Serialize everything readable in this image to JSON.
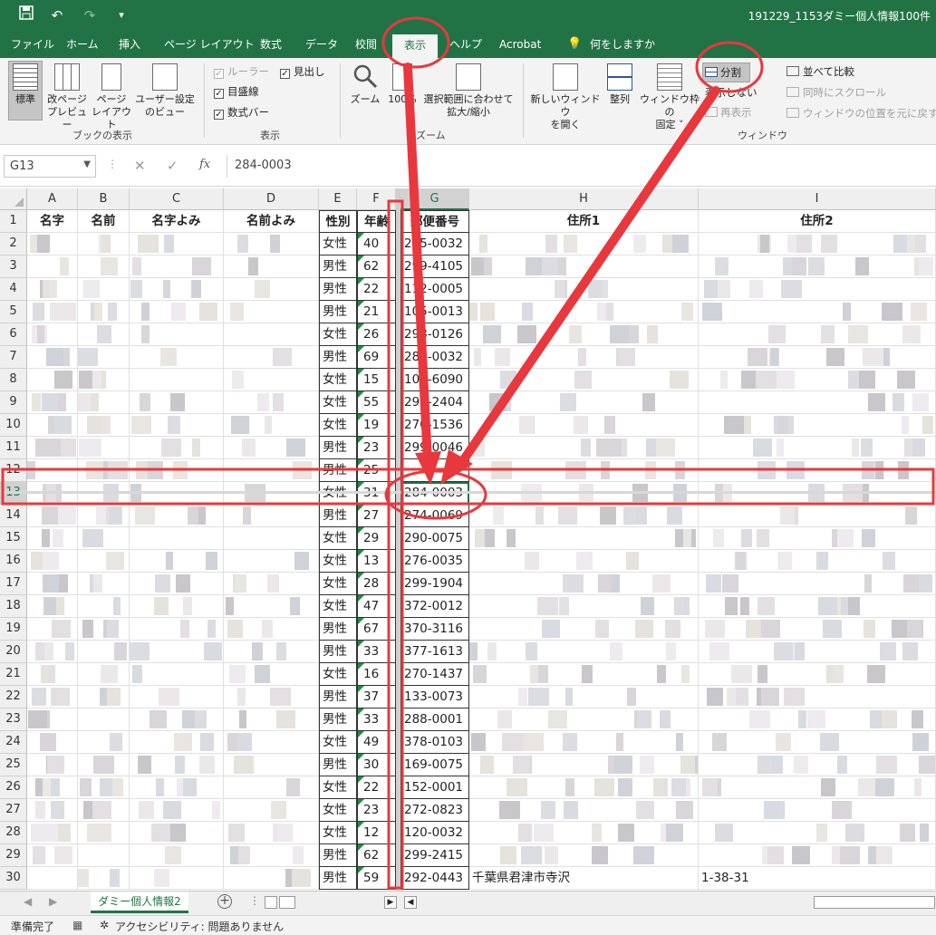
{
  "window": {
    "title": "191229_1153ダミー個人情報100件"
  },
  "qat": {
    "save_icon": "save-icon",
    "undo_icon": "undo-icon",
    "redo_icon": "redo-icon",
    "customize_icon": "customize-icon"
  },
  "tabs": [
    {
      "label": "ファイル"
    },
    {
      "label": "ホーム"
    },
    {
      "label": "挿入"
    },
    {
      "label": "ページ レイアウト"
    },
    {
      "label": "数式"
    },
    {
      "label": "データ"
    },
    {
      "label": "校閲"
    },
    {
      "label": "表示"
    },
    {
      "label": "ヘルプ"
    },
    {
      "label": "Acrobat"
    },
    {
      "label": "何をしますか"
    }
  ],
  "ribbon": {
    "workbook_views": {
      "group_label": "ブックの表示",
      "normal": "標準",
      "page_break_1": "改ページ",
      "page_break_2": "プレビュー",
      "page_layout_1": "ページ",
      "page_layout_2": "レイアウト",
      "custom_1": "ユーザー設定",
      "custom_2": "のビュー"
    },
    "show": {
      "group_label": "表示",
      "ruler": "ルーラー",
      "gridlines": "目盛線",
      "formula_bar": "数式バー",
      "headings": "見出し"
    },
    "zoom": {
      "group_label": "ズーム",
      "zoom": "ズーム",
      "zoom100": "100%",
      "zoom_sel_1": "選択範囲に合わせて",
      "zoom_sel_2": "拡大/縮小"
    },
    "window": {
      "group_label": "ウィンドウ",
      "new_window_1": "新しいウィンドウ",
      "new_window_2": "を開く",
      "arrange": "整列",
      "freeze_1": "ウィンドウ枠の",
      "freeze_2": "固定 ˅",
      "split": "分割",
      "hide": "表示しない",
      "unhide": "再表示",
      "side_by_side": "並べて比較",
      "sync_scroll": "同時にスクロール",
      "reset_pos": "ウィンドウの位置を元に戻す"
    }
  },
  "formula_bar": {
    "name_box": "G13",
    "cancel": "✕",
    "enter": "✓",
    "fx": "fx",
    "content": "284-0003"
  },
  "columns": [
    "A",
    "B",
    "C",
    "D",
    "E",
    "F",
    "G",
    "H",
    "I"
  ],
  "headers": [
    "名字",
    "名前",
    "名字よみ",
    "名前よみ",
    "性別",
    "年齢",
    "郵便番号",
    "住所1",
    "住所2"
  ],
  "rows": [
    {
      "n": "2",
      "gender": "女性",
      "age": "40",
      "zip": "285-0032"
    },
    {
      "n": "3",
      "gender": "男性",
      "age": "62",
      "zip": "299-4105"
    },
    {
      "n": "4",
      "gender": "男性",
      "age": "22",
      "zip": "112-0005"
    },
    {
      "n": "5",
      "gender": "男性",
      "age": "21",
      "zip": "105-0013"
    },
    {
      "n": "6",
      "gender": "女性",
      "age": "26",
      "zip": "298-0126"
    },
    {
      "n": "7",
      "gender": "男性",
      "age": "69",
      "zip": "283-0032"
    },
    {
      "n": "8",
      "gender": "女性",
      "age": "15",
      "zip": "100-6090"
    },
    {
      "n": "9",
      "gender": "女性",
      "age": "55",
      "zip": "299-2404"
    },
    {
      "n": "10",
      "gender": "女性",
      "age": "19",
      "zip": "270-1536"
    },
    {
      "n": "11",
      "gender": "男性",
      "age": "23",
      "zip": "299-0046"
    },
    {
      "n": "12",
      "gender": "男性",
      "age": "25",
      "zip": ""
    },
    {
      "n": "13",
      "gender": "女性",
      "age": "31",
      "zip": "284-0003"
    },
    {
      "n": "14",
      "gender": "男性",
      "age": "27",
      "zip": "274-0069"
    },
    {
      "n": "15",
      "gender": "女性",
      "age": "29",
      "zip": "290-0075"
    },
    {
      "n": "16",
      "gender": "女性",
      "age": "13",
      "zip": "276-0035"
    },
    {
      "n": "17",
      "gender": "女性",
      "age": "28",
      "zip": "299-1904"
    },
    {
      "n": "18",
      "gender": "女性",
      "age": "47",
      "zip": "372-0012"
    },
    {
      "n": "19",
      "gender": "男性",
      "age": "67",
      "zip": "370-3116"
    },
    {
      "n": "20",
      "gender": "男性",
      "age": "33",
      "zip": "377-1613"
    },
    {
      "n": "21",
      "gender": "女性",
      "age": "16",
      "zip": "270-1437"
    },
    {
      "n": "22",
      "gender": "男性",
      "age": "37",
      "zip": "133-0073"
    },
    {
      "n": "23",
      "gender": "男性",
      "age": "33",
      "zip": "288-0001"
    },
    {
      "n": "24",
      "gender": "女性",
      "age": "49",
      "zip": "378-0103"
    },
    {
      "n": "25",
      "gender": "男性",
      "age": "30",
      "zip": "169-0075"
    },
    {
      "n": "26",
      "gender": "女性",
      "age": "22",
      "zip": "152-0001"
    },
    {
      "n": "27",
      "gender": "女性",
      "age": "23",
      "zip": "272-0823"
    },
    {
      "n": "28",
      "gender": "女性",
      "age": "12",
      "zip": "120-0032"
    },
    {
      "n": "29",
      "gender": "男性",
      "age": "62",
      "zip": "299-2415"
    },
    {
      "n": "30",
      "gender": "男性",
      "age": "59",
      "zip": "292-0443",
      "addr1": "千葉県君津市寺沢",
      "addr2": "1-38-31"
    }
  ],
  "sheet": {
    "tab_label": "ダミー個人情報2",
    "add_icon": "add-sheet-icon"
  },
  "status": {
    "ready": "準備完了",
    "accessibility": "アクセシビリティ: 問題ありません"
  },
  "colors": {
    "excel_green": "#217346",
    "annotation_red": "#e8383d"
  }
}
